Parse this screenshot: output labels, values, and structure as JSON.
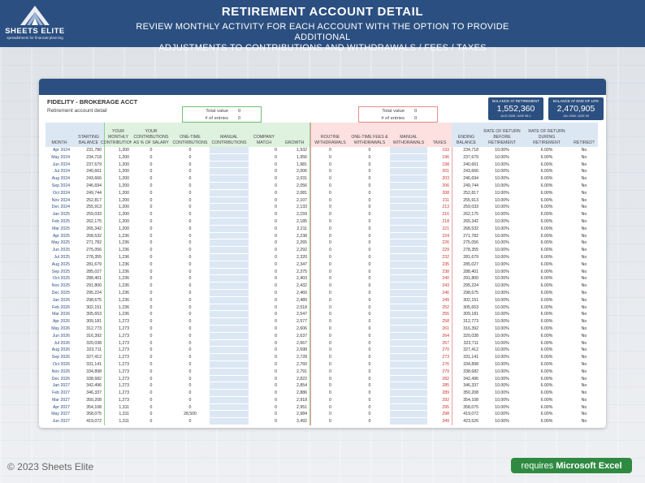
{
  "header": {
    "title": "RETIREMENT ACCOUNT DETAIL",
    "subtitle": "REVIEW MONTHLY ACTIVITY FOR EACH ACCOUNT WITH  THE OPTION TO PROVIDE  ADDITIONAL\nADJUSTMENTS TO CONTRIBUTIONS AND WITHDRAWALS / FEES / TAXES",
    "logo_title": "SHEETS ELITE",
    "logo_sub": "spreadsheets for financial planning"
  },
  "account": {
    "name": "FIDELITY - BROKERAGE ACCT",
    "description": "Retirement account detail"
  },
  "totals_green": {
    "total_label": "Total value",
    "total": "0",
    "entries_label": "# of entries",
    "entries": "0"
  },
  "totals_red": {
    "total_label": "Total value",
    "total": "0",
    "entries_label": "# of entries",
    "entries": "0"
  },
  "balance_retirement": {
    "label": "BALANCE AT RETIREMENT",
    "value": "1,552,360",
    "date": "AUG 2028 / AGE 58.1"
  },
  "balance_end": {
    "label": "BALANCE AT END OF LIFE",
    "value": "2,470,905",
    "date": "JUL 2060 / AGE 90"
  },
  "columns": [
    "MONTH",
    "STARTING\nBALANCE",
    "YOUR\nMONTHLY\nCONTRIBUTIONS",
    "YOUR\nCONTRIBUTIONS\nAS % OF SALARY",
    "ONE-TIME\nCONTRIBUTIONS",
    "MANUAL\nCONTRIBUTIONS",
    "COMPANY\nMATCH",
    "GROWTH",
    "ROUTINE\nWITHDRAWALS",
    "ONE-TIME FEES &\nWITHDRAWALS",
    "MANUAL\nWITHDRAWALS",
    "TAXES",
    "ENDING\nBALANCE",
    "RATE OF RETURN\nBEFORE\nRETIREMENT",
    "RATE OF RETURN\nDURING\nRETIREMENT",
    "RETIRED?"
  ],
  "rows": [
    [
      "Apr 2024",
      "231,780",
      "1,200",
      "0",
      "0",
      "",
      "0",
      "1,932",
      "0",
      "0",
      "",
      "193",
      "234,718",
      "10.00%",
      "6.00%",
      "No"
    ],
    [
      "May 2024",
      "234,718",
      "1,200",
      "0",
      "0",
      "",
      "0",
      "1,956",
      "0",
      "0",
      "",
      "196",
      "237,679",
      "10.00%",
      "6.00%",
      "No"
    ],
    [
      "Jun 2024",
      "237,679",
      "1,200",
      "0",
      "0",
      "",
      "0",
      "1,981",
      "0",
      "0",
      "",
      "198",
      "240,661",
      "10.00%",
      "6.00%",
      "No"
    ],
    [
      "Jul 2024",
      "240,661",
      "1,200",
      "0",
      "0",
      "",
      "0",
      "2,006",
      "0",
      "0",
      "",
      "201",
      "243,666",
      "10.00%",
      "6.00%",
      "No"
    ],
    [
      "Aug 2024",
      "243,666",
      "1,200",
      "0",
      "0",
      "",
      "0",
      "2,031",
      "0",
      "0",
      "",
      "203",
      "246,694",
      "10.00%",
      "6.00%",
      "No"
    ],
    [
      "Sep 2024",
      "246,694",
      "1,200",
      "0",
      "0",
      "",
      "0",
      "2,056",
      "0",
      "0",
      "",
      "206",
      "249,744",
      "10.00%",
      "6.00%",
      "No"
    ],
    [
      "Oct 2024",
      "249,744",
      "1,200",
      "0",
      "0",
      "",
      "0",
      "2,081",
      "0",
      "0",
      "",
      "208",
      "252,817",
      "10.00%",
      "6.00%",
      "No"
    ],
    [
      "Nov 2024",
      "252,817",
      "1,200",
      "0",
      "0",
      "",
      "0",
      "2,107",
      "0",
      "0",
      "",
      "211",
      "255,913",
      "10.00%",
      "6.00%",
      "No"
    ],
    [
      "Dec 2024",
      "255,913",
      "1,200",
      "0",
      "0",
      "",
      "0",
      "2,133",
      "0",
      "0",
      "",
      "213",
      "259,033",
      "10.00%",
      "6.00%",
      "No"
    ],
    [
      "Jan 2025",
      "259,033",
      "1,200",
      "0",
      "0",
      "",
      "0",
      "2,159",
      "0",
      "0",
      "",
      "216",
      "262,175",
      "10.00%",
      "6.00%",
      "No"
    ],
    [
      "Feb 2025",
      "262,175",
      "1,200",
      "0",
      "0",
      "",
      "0",
      "2,185",
      "0",
      "0",
      "",
      "218",
      "265,342",
      "10.00%",
      "6.00%",
      "No"
    ],
    [
      "Mar 2025",
      "265,342",
      "1,200",
      "0",
      "0",
      "",
      "0",
      "2,211",
      "0",
      "0",
      "",
      "221",
      "268,532",
      "10.00%",
      "6.00%",
      "No"
    ],
    [
      "Apr 2025",
      "268,532",
      "1,236",
      "0",
      "0",
      "",
      "0",
      "2,238",
      "0",
      "0",
      "",
      "224",
      "271,782",
      "10.00%",
      "6.00%",
      "No"
    ],
    [
      "May 2025",
      "271,782",
      "1,236",
      "0",
      "0",
      "",
      "0",
      "2,265",
      "0",
      "0",
      "",
      "226",
      "275,056",
      "10.00%",
      "6.00%",
      "No"
    ],
    [
      "Jun 2025",
      "275,056",
      "1,236",
      "0",
      "0",
      "",
      "0",
      "2,292",
      "0",
      "0",
      "",
      "229",
      "278,355",
      "10.00%",
      "6.00%",
      "No"
    ],
    [
      "Jul 2025",
      "278,355",
      "1,236",
      "0",
      "0",
      "",
      "0",
      "2,320",
      "0",
      "0",
      "",
      "232",
      "281,679",
      "10.00%",
      "6.00%",
      "No"
    ],
    [
      "Aug 2025",
      "281,679",
      "1,236",
      "0",
      "0",
      "",
      "0",
      "2,347",
      "0",
      "0",
      "",
      "235",
      "285,027",
      "10.00%",
      "6.00%",
      "No"
    ],
    [
      "Sep 2025",
      "285,027",
      "1,236",
      "0",
      "0",
      "",
      "0",
      "2,375",
      "0",
      "0",
      "",
      "238",
      "288,401",
      "10.00%",
      "6.00%",
      "No"
    ],
    [
      "Oct 2025",
      "288,401",
      "1,236",
      "0",
      "0",
      "",
      "0",
      "2,403",
      "0",
      "0",
      "",
      "240",
      "291,800",
      "10.00%",
      "6.00%",
      "No"
    ],
    [
      "Nov 2025",
      "291,800",
      "1,236",
      "0",
      "0",
      "",
      "0",
      "2,432",
      "0",
      "0",
      "",
      "243",
      "295,224",
      "10.00%",
      "6.00%",
      "No"
    ],
    [
      "Dec 2025",
      "295,224",
      "1,236",
      "0",
      "0",
      "",
      "0",
      "2,460",
      "0",
      "0",
      "",
      "246",
      "298,675",
      "10.00%",
      "6.00%",
      "No"
    ],
    [
      "Jan 2026",
      "298,675",
      "1,236",
      "0",
      "0",
      "",
      "0",
      "2,489",
      "0",
      "0",
      "",
      "249",
      "302,151",
      "10.00%",
      "6.00%",
      "No"
    ],
    [
      "Feb 2026",
      "302,151",
      "1,236",
      "0",
      "0",
      "",
      "0",
      "2,518",
      "0",
      "0",
      "",
      "252",
      "305,653",
      "10.00%",
      "6.00%",
      "No"
    ],
    [
      "Mar 2026",
      "305,653",
      "1,236",
      "0",
      "0",
      "",
      "0",
      "2,547",
      "0",
      "0",
      "",
      "255",
      "309,181",
      "10.00%",
      "6.00%",
      "No"
    ],
    [
      "Apr 2026",
      "309,181",
      "1,273",
      "0",
      "0",
      "",
      "0",
      "2,577",
      "0",
      "0",
      "",
      "258",
      "312,773",
      "10.00%",
      "6.00%",
      "No"
    ],
    [
      "May 2026",
      "312,773",
      "1,273",
      "0",
      "0",
      "",
      "0",
      "2,606",
      "0",
      "0",
      "",
      "261",
      "316,392",
      "10.00%",
      "6.00%",
      "No"
    ],
    [
      "Jun 2026",
      "316,392",
      "1,273",
      "0",
      "0",
      "",
      "0",
      "2,637",
      "0",
      "0",
      "",
      "264",
      "320,038",
      "10.00%",
      "6.00%",
      "No"
    ],
    [
      "Jul 2026",
      "320,038",
      "1,273",
      "0",
      "0",
      "",
      "0",
      "2,667",
      "0",
      "0",
      "",
      "267",
      "323,711",
      "10.00%",
      "6.00%",
      "No"
    ],
    [
      "Aug 2026",
      "323,711",
      "1,273",
      "0",
      "0",
      "",
      "0",
      "2,698",
      "0",
      "0",
      "",
      "270",
      "327,412",
      "10.00%",
      "6.00%",
      "No"
    ],
    [
      "Sep 2026",
      "327,412",
      "1,273",
      "0",
      "0",
      "",
      "0",
      "2,728",
      "0",
      "0",
      "",
      "273",
      "331,141",
      "10.00%",
      "6.00%",
      "No"
    ],
    [
      "Oct 2026",
      "331,141",
      "1,273",
      "0",
      "0",
      "",
      "0",
      "2,760",
      "0",
      "0",
      "",
      "276",
      "334,898",
      "10.00%",
      "6.00%",
      "No"
    ],
    [
      "Nov 2026",
      "334,898",
      "1,273",
      "0",
      "0",
      "",
      "0",
      "2,791",
      "0",
      "0",
      "",
      "279",
      "338,682",
      "10.00%",
      "6.00%",
      "No"
    ],
    [
      "Dec 2026",
      "338,682",
      "1,273",
      "0",
      "0",
      "",
      "0",
      "2,822",
      "0",
      "0",
      "",
      "282",
      "342,496",
      "10.00%",
      "6.00%",
      "No"
    ],
    [
      "Jan 2027",
      "342,496",
      "1,273",
      "0",
      "0",
      "",
      "0",
      "2,854",
      "0",
      "0",
      "",
      "285",
      "346,337",
      "10.00%",
      "6.00%",
      "No"
    ],
    [
      "Feb 2027",
      "346,337",
      "1,273",
      "0",
      "0",
      "",
      "0",
      "2,886",
      "0",
      "0",
      "",
      "289",
      "350,208",
      "10.00%",
      "6.00%",
      "No"
    ],
    [
      "Mar 2027",
      "350,208",
      "1,273",
      "0",
      "0",
      "",
      "0",
      "2,918",
      "0",
      "0",
      "",
      "292",
      "354,108",
      "10.00%",
      "6.00%",
      "No"
    ],
    [
      "Apr 2027",
      "354,108",
      "1,311",
      "0",
      "0",
      "",
      "0",
      "2,951",
      "0",
      "0",
      "",
      "295",
      "358,075",
      "10.00%",
      "6.00%",
      "No"
    ],
    [
      "May 2027",
      "358,075",
      "1,311",
      "0",
      "28,500",
      "",
      "0",
      "2,984",
      "0",
      "0",
      "",
      "298",
      "419,072",
      "10.00%",
      "6.00%",
      "No"
    ],
    [
      "Jun 2027",
      "419,072",
      "1,311",
      "0",
      "0",
      "",
      "0",
      "3,492",
      "0",
      "0",
      "",
      "349",
      "423,526",
      "10.00%",
      "6.00%",
      "No"
    ]
  ],
  "footer": {
    "copyright": "© 2023 Sheets Elite",
    "requires": "requires",
    "requires_bold": "Microsoft Excel"
  }
}
